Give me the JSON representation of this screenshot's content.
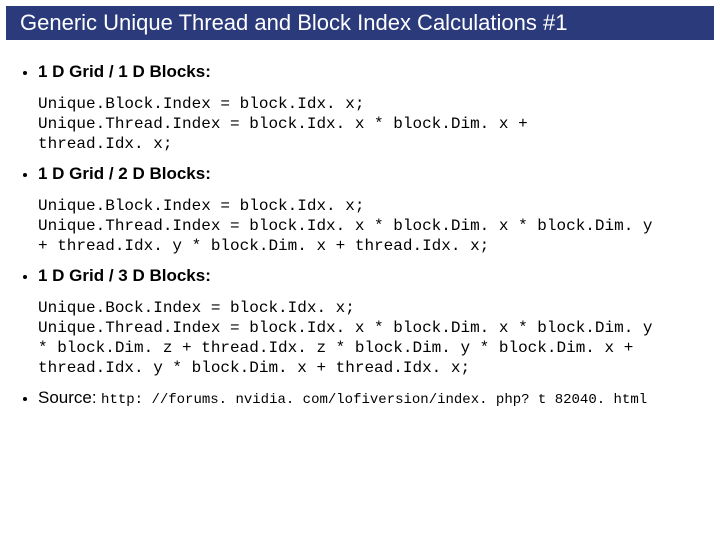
{
  "title": "Generic Unique Thread and Block Index Calculations #1",
  "sections": [
    {
      "heading": "1 D Grid / 1 D Blocks:",
      "code": "Unique.Block.Index = block.Idx. x;\nUnique.Thread.Index = block.Idx. x * block.Dim. x +\nthread.Idx. x;"
    },
    {
      "heading": "1 D Grid / 2 D Blocks:",
      "code": "Unique.Block.Index = block.Idx. x;\nUnique.Thread.Index = block.Idx. x * block.Dim. x * block.Dim. y\n+ thread.Idx. y * block.Dim. x + thread.Idx. x;"
    },
    {
      "heading": "1 D Grid / 3 D Blocks:",
      "code": "Unique.Bock.Index = block.Idx. x;\nUnique.Thread.Index = block.Idx. x * block.Dim. x * block.Dim. y\n* block.Dim. z + thread.Idx. z * block.Dim. y * block.Dim. x +\nthread.Idx. y * block.Dim. x + thread.Idx. x;"
    }
  ],
  "source": {
    "label": "Source:",
    "url": "http: //forums. nvidia. com/lofiversion/index. php? t 82040. html"
  }
}
